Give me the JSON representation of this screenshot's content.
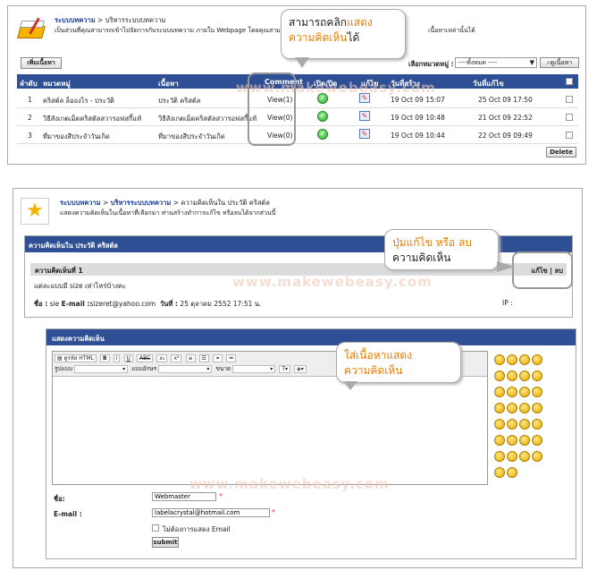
{
  "top": {
    "breadcrumb_link": "ระบบบทความ",
    "breadcrumb_rest": " > บริหารระบบบทความ",
    "description": "เป็นส่วนที่คุณสามารถเข้าไปจัดการกับระบบบทความ ภายใน Webpage โดยคุณสามารถ",
    "description_tail": "เนื้อหาเหล่านั้นได้",
    "add_button": "เพิ่มเนื้อหา",
    "category_label": "เลือกหมวดหมู่ :",
    "category_value": "----ทั้งหมด ----",
    "view_button": "ดูเนื้อหา",
    "columns": [
      "ลำดับ",
      "หมวดหมู่",
      "เนื้อหา",
      "Comment",
      "เปิด/ปิด",
      "แก้ไข",
      "วันที่สร้าง",
      "วันที่แก้ไข"
    ],
    "rows": [
      {
        "no": "1",
        "category": "คริสต์ล ล็อองไร - ประวัติ",
        "content": "ประวัติ คริสต์ล",
        "comment": "View(1)",
        "created": "19 Oct 09 15:07",
        "modified": "25 Oct 09 17:50"
      },
      {
        "no": "2",
        "category": "วิธีสังเกตเม็ดคริสตัลสวารอฟสกี้แท้",
        "content": "วิธีสังเกตเม็ดคริสตัลสวารอฟสกี้แท้",
        "comment": "View(0)",
        "created": "19 Oct 09 10:48",
        "modified": "21 Oct 09 22:52"
      },
      {
        "no": "3",
        "category": "ที่มาของสีประจำวันเกิด",
        "content": "ที่มาของสีประจำวันเกิด",
        "comment": "View(0)",
        "created": "19 Oct 09 10:44",
        "modified": "22 Oct 09 09:49"
      }
    ],
    "delete_button": "Delete",
    "watermark": "www.makewebeasy.com",
    "callout_plain": "สามารถคลิก",
    "callout_orange1": "แสดง",
    "callout_orange2": "ความคิดเห็น",
    "callout_tail": "ได้"
  },
  "bottom": {
    "breadcrumb_link1": "ระบบบทความ",
    "breadcrumb_sep1": " > ",
    "breadcrumb_link2": "บริหารระบบบทความ",
    "breadcrumb_rest": " > ความคิดเห็นใน ประวัติ คริสต์ล",
    "description": "แสดงความคิดเห็นในเนื้อหาที่เลือกมา ท่านสร้างทำการแก้ไข หรือลบได้จากส่วนนี้",
    "comments_header": "ความคิดเห็นใน ประวัติ คริสต์ล",
    "comment_title": "ความคิดเห็นที่ 1",
    "comment_actions": "แก้ไข | ลบ",
    "comment_body": "แต่ละแบบมี size เท่าไหร่บ้างคะ",
    "name_label": "ชื่อ :",
    "name_value": "sie",
    "email_label": "E-mail :",
    "email_value": "sizeret@yahoo.com",
    "date_label": "วันที่ :",
    "date_value": "25 ตุลาคม 2552 17:51 น.",
    "ip_label": "IP :",
    "callout_orange": "ปุ่มแก้ไข หรือ ลบ",
    "callout_plain": "ความคิดเห็น",
    "form_header": "แสดงความคิดเห็น",
    "toolbar_source": "ดูรหัส HTML",
    "toolbar_format": "รูปแบบ",
    "toolbar_font": "แบบอักษร",
    "toolbar_size": "ขนาด",
    "callout2_line1": "ใส่เนื้อหา",
    "callout2_line1b": "แสดง",
    "callout2_line2": "ความคิดเห็น",
    "form_name_label": "ชื่อ:",
    "form_name_value": "Webmaster",
    "form_email_label": "E-mail :",
    "form_email_value": "labelacrystal@hotmail.com",
    "hide_email_label": "ไม่ต้องการแสดง Email",
    "submit_label": "submit",
    "watermark": "www.makewebeasy.com"
  }
}
